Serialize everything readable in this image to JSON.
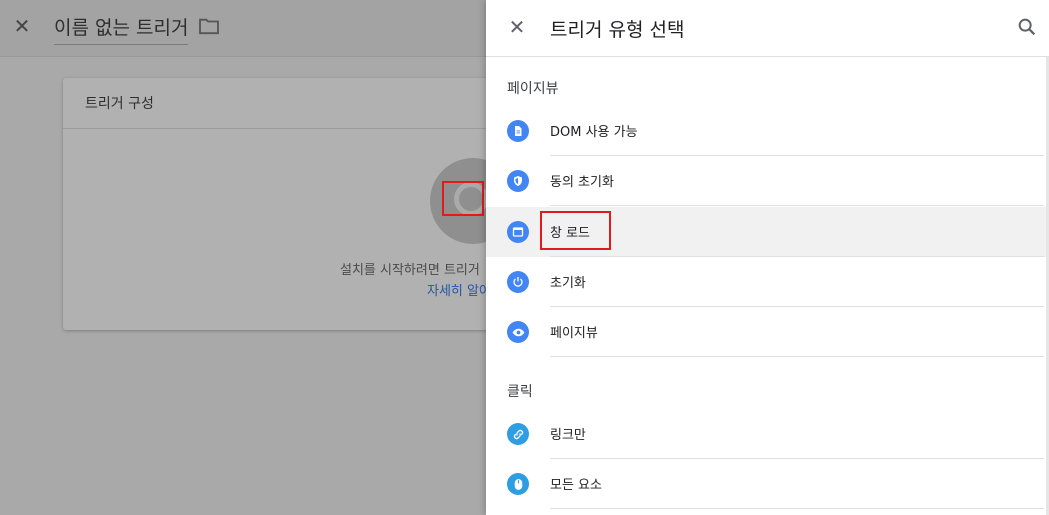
{
  "background": {
    "title": "이름 없는 트리거",
    "card_title": "트리거 구성",
    "card_text": "설치를 시작하려면 트리거",
    "card_link": "자세히 알아"
  },
  "panel": {
    "title": "트리거 유형 선택",
    "sections": [
      {
        "label": "페이지뷰",
        "items": [
          {
            "label": "DOM 사용 가능",
            "icon": "document-icon",
            "color": "#4285f4"
          },
          {
            "label": "동의 초기화",
            "icon": "shield-icon",
            "color": "#4285f4"
          },
          {
            "label": "창 로드",
            "icon": "window-icon",
            "color": "#4285f4"
          },
          {
            "label": "초기화",
            "icon": "power-icon",
            "color": "#4285f4"
          },
          {
            "label": "페이지뷰",
            "icon": "eye-icon",
            "color": "#4285f4"
          }
        ]
      },
      {
        "label": "클릭",
        "items": [
          {
            "label": "링크만",
            "icon": "link-icon",
            "color": "#2f9de2"
          },
          {
            "label": "모든 요소",
            "icon": "mouse-icon",
            "color": "#2f9de2"
          }
        ]
      }
    ]
  },
  "colors": {
    "accent": "#4285f4",
    "click_accent": "#2f9de2",
    "highlight_box": "#e01b1b"
  }
}
